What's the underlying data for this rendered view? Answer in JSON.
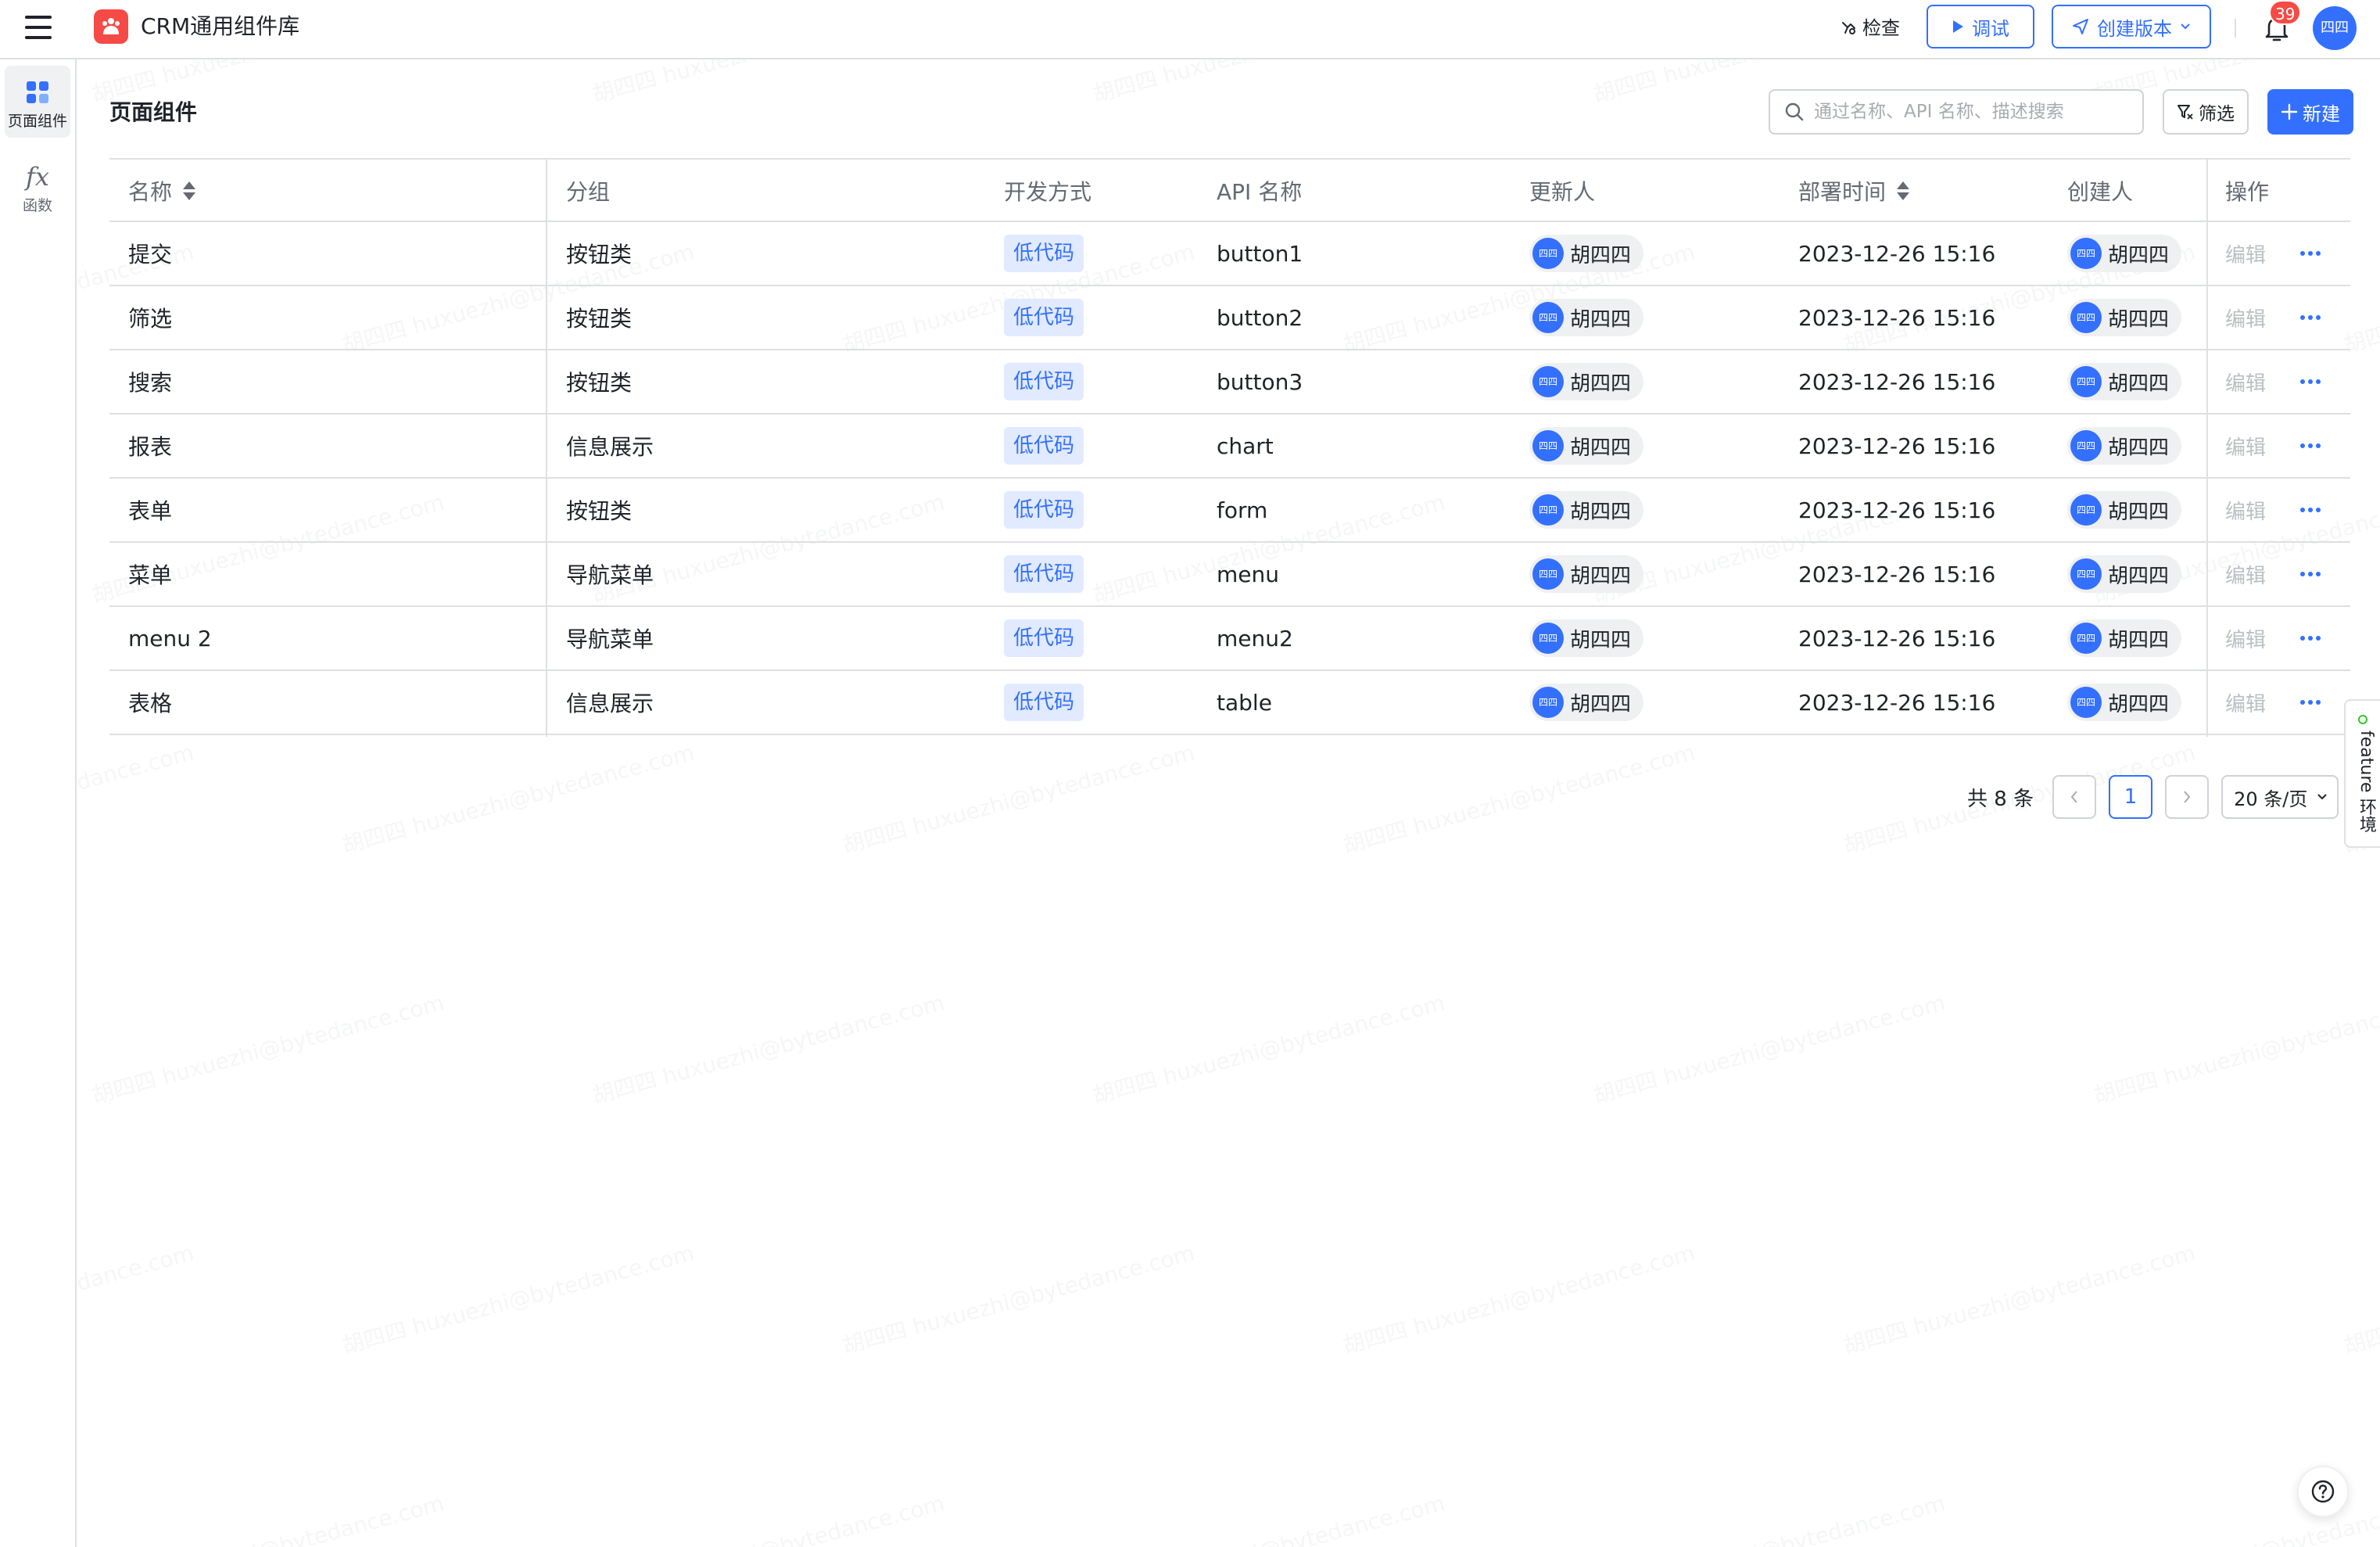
{
  "app": {
    "title": "CRM通用组件库"
  },
  "header": {
    "inspect_label": "检查",
    "debug_label": "调试",
    "create_version_label": "创建版本",
    "notification_count": "39",
    "avatar_text": "四四"
  },
  "sidebar": {
    "items": [
      {
        "label": "页面组件",
        "icon": "grid-apps-icon",
        "active": true
      },
      {
        "label": "函数",
        "icon": "fx-function-icon",
        "active": false
      }
    ],
    "fx_glyph": "fx"
  },
  "page": {
    "title": "页面组件",
    "search_placeholder": "通过名称、API 名称、描述搜索",
    "filter_label": "筛选",
    "new_label": "新建"
  },
  "table": {
    "columns": [
      "名称",
      "分组",
      "开发方式",
      "API 名称",
      "更新人",
      "部署时间",
      "创建人",
      "操作"
    ],
    "rows": [
      {
        "name": "提交",
        "group": "按钮类",
        "dev": "低代码",
        "api": "button1",
        "updater": "胡四四",
        "time": "2023-12-26 15:16",
        "creator": "胡四四"
      },
      {
        "name": "筛选",
        "group": "按钮类",
        "dev": "低代码",
        "api": "button2",
        "updater": "胡四四",
        "time": "2023-12-26 15:16",
        "creator": "胡四四"
      },
      {
        "name": "搜索",
        "group": "按钮类",
        "dev": "低代码",
        "api": "button3",
        "updater": "胡四四",
        "time": "2023-12-26 15:16",
        "creator": "胡四四"
      },
      {
        "name": "报表",
        "group": "信息展示",
        "dev": "低代码",
        "api": "chart",
        "updater": "胡四四",
        "time": "2023-12-26 15:16",
        "creator": "胡四四"
      },
      {
        "name": "表单",
        "group": "按钮类",
        "dev": "低代码",
        "api": "form",
        "updater": "胡四四",
        "time": "2023-12-26 15:16",
        "creator": "胡四四"
      },
      {
        "name": "菜单",
        "group": "导航菜单",
        "dev": "低代码",
        "api": "menu",
        "updater": "胡四四",
        "time": "2023-12-26 15:16",
        "creator": "胡四四"
      },
      {
        "name": "menu 2",
        "group": "导航菜单",
        "dev": "低代码",
        "api": "menu2",
        "updater": "胡四四",
        "time": "2023-12-26 15:16",
        "creator": "胡四四"
      },
      {
        "name": "表格",
        "group": "信息展示",
        "dev": "低代码",
        "api": "table",
        "updater": "胡四四",
        "time": "2023-12-26 15:16",
        "creator": "胡四四"
      }
    ],
    "chip_avatar_text": "四四",
    "edit_label": "编辑"
  },
  "pagination": {
    "total_text": "共 8 条",
    "current_page": "1",
    "page_size": "20 条/页"
  },
  "env_tab": {
    "label": "feature 环境"
  },
  "watermark": {
    "text": "胡四四 huxuezhi@bytedance.com"
  },
  "colors": {
    "accent": "#3370ff",
    "danger": "#f54a45",
    "tag_bg": "#e1eaff",
    "border": "#dee0e3",
    "env_dot": "#34c724"
  }
}
